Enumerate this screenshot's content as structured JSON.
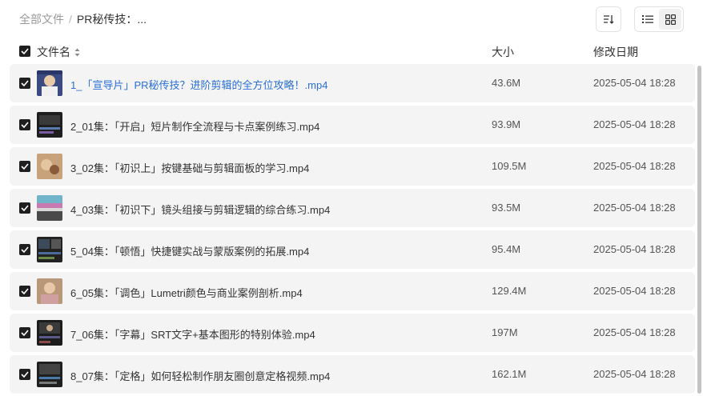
{
  "breadcrumb": {
    "root": "全部文件",
    "separator": "/",
    "current": "PR秘传技：..."
  },
  "header": {
    "name": "文件名",
    "size": "大小",
    "date": "修改日期"
  },
  "files": [
    {
      "name": "1_「宣导片」PR秘传技？进阶剪辑的全方位攻略！.mp4",
      "size": "43.6M",
      "date": "2025-05-04 18:28"
    },
    {
      "name": "2_01集：「开启」短片制作全流程与卡点案例练习.mp4",
      "size": "93.9M",
      "date": "2025-05-04 18:28"
    },
    {
      "name": "3_02集：「初识上」按键基础与剪辑面板的学习.mp4",
      "size": "109.5M",
      "date": "2025-05-04 18:28"
    },
    {
      "name": "4_03集：「初识下」镜头组接与剪辑逻辑的综合练习.mp4",
      "size": "93.5M",
      "date": "2025-05-04 18:28"
    },
    {
      "name": "5_04集：「顿悟」快捷键实战与蒙版案例的拓展.mp4",
      "size": "95.4M",
      "date": "2025-05-04 18:28"
    },
    {
      "name": "6_05集：「调色」Lumetri颜色与商业案例剖析.mp4",
      "size": "129.4M",
      "date": "2025-05-04 18:28"
    },
    {
      "name": "7_06集：「字幕」SRT文字+基本图形的特别体验.mp4",
      "size": "197M",
      "date": "2025-05-04 18:28"
    },
    {
      "name": "8_07集：「定格」如何轻松制作朋友圈创意定格视频.mp4",
      "size": "162.1M",
      "date": "2025-05-04 18:28"
    }
  ],
  "colors": {
    "highlight_link": "#2a6fd6",
    "row_bg": "#f4f4f4",
    "checkbox": "#1f1f1f"
  }
}
